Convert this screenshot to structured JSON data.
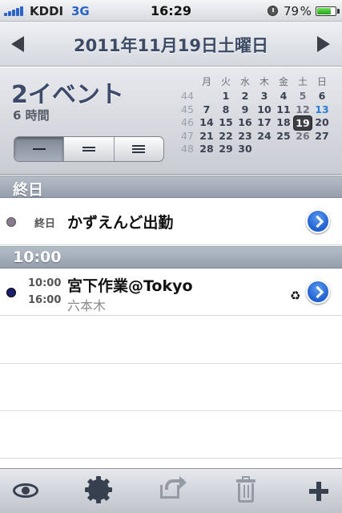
{
  "status_bar": {
    "carrier": "KDDI",
    "network": "3G",
    "time": "16:29",
    "battery_percent": "79 %",
    "battery_level": 0.79,
    "signal_bars": 5
  },
  "header": {
    "date": "2011年11月19日土曜日"
  },
  "summary": {
    "event_count": "2イベント",
    "duration": "6 時間",
    "view_modes": [
      {
        "icon": "single-bar-icon",
        "active": true
      },
      {
        "icon": "double-bar-icon",
        "active": false
      },
      {
        "icon": "triple-bar-icon",
        "active": false
      }
    ]
  },
  "mini_calendar": {
    "weekdays": [
      "月",
      "火",
      "水",
      "木",
      "金",
      "土",
      "日"
    ],
    "weeks": [
      {
        "week": "44",
        "days": [
          "",
          "1",
          "2",
          "3",
          "4",
          "5",
          "6"
        ]
      },
      {
        "week": "45",
        "days": [
          "7",
          "8",
          "9",
          "10",
          "11",
          "12",
          "13"
        ]
      },
      {
        "week": "46",
        "days": [
          "14",
          "15",
          "16",
          "17",
          "18",
          "19",
          "20"
        ]
      },
      {
        "week": "47",
        "days": [
          "21",
          "22",
          "23",
          "24",
          "25",
          "26",
          "27"
        ]
      },
      {
        "week": "48",
        "days": [
          "28",
          "29",
          "30",
          "",
          "",
          "",
          ""
        ]
      }
    ],
    "today": "19",
    "highlight_sunday": "13"
  },
  "sections": [
    {
      "label": "終日",
      "events": [
        {
          "time_label": "終日",
          "title": "かずえんど出勤",
          "dot_color": "#8a7a8f"
        }
      ]
    },
    {
      "label": "10:00",
      "events": [
        {
          "start": "10:00",
          "end": "16:00",
          "title": "宮下作業@Tokyo",
          "location": "六本木",
          "dot_color": "#1b1f6b",
          "recurring_icon": "♻"
        }
      ]
    }
  ],
  "toolbar": {
    "icons": [
      "eye-icon",
      "gear-icon",
      "share-icon",
      "trash-icon",
      "plus-icon"
    ]
  }
}
